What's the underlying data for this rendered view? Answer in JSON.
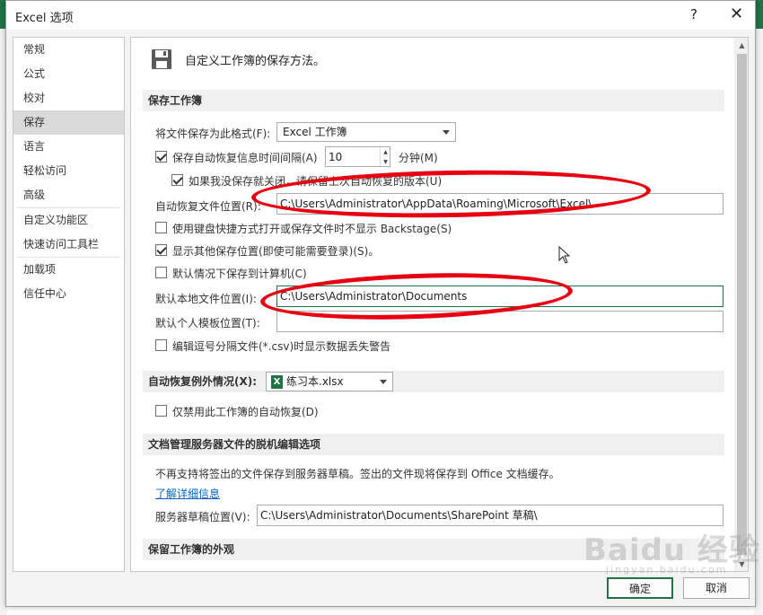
{
  "window": {
    "title": "Excel 选项",
    "help": "?",
    "close": "✕"
  },
  "nav": {
    "items": [
      {
        "label": "常规",
        "selected": false
      },
      {
        "label": "公式",
        "selected": false
      },
      {
        "label": "校对",
        "selected": false
      },
      {
        "label": "保存",
        "selected": true
      },
      {
        "label": "语言",
        "selected": false
      },
      {
        "label": "轻松访问",
        "selected": false
      },
      {
        "label": "高级",
        "selected": false
      },
      {
        "label": "自定义功能区",
        "selected": false
      },
      {
        "label": "快速访问工具栏",
        "selected": false
      },
      {
        "label": "加载项",
        "selected": false
      },
      {
        "label": "信任中心",
        "selected": false
      }
    ]
  },
  "header": {
    "text": "自定义工作簿的保存方法。",
    "icon": "floppy-disk-icon"
  },
  "sections": {
    "save_workbooks": "保存工作簿",
    "autorecover_exceptions": "自动恢复例外情况(X):",
    "offline_editing": "文档管理服务器文件的脱机编辑选项",
    "preserve_visual": "保留工作簿的外观"
  },
  "save": {
    "format_label": "将文件保存为此格式(F):",
    "format_value": "Excel 工作簿",
    "autorecover_label": "保存自动恢复信息时间间隔(A)",
    "autorecover_checked": true,
    "autorecover_minutes": "10",
    "minutes_unit": "分钟(M)",
    "keep_last_label": "如果我没保存就关闭，请保留上次自动恢复的版本(U)",
    "keep_last_checked": true,
    "autorecover_location_label": "自动恢复文件位置(R):",
    "autorecover_location_value": "C:\\Users\\Administrator\\AppData\\Roaming\\Microsoft\\Excel\\",
    "no_backstage_label": "使用键盘快捷方式打开或保存文件时不显示 Backstage(S)",
    "no_backstage_checked": false,
    "show_additional_label": "显示其他保存位置(即使可能需要登录)(S)。",
    "show_additional_checked": true,
    "save_to_computer_label": "默认情况下保存到计算机(C)",
    "save_to_computer_checked": false,
    "default_local_label": "默认本地文件位置(I):",
    "default_local_value": "C:\\Users\\Administrator\\Documents",
    "default_template_label": "默认个人模板位置(T):",
    "default_template_value": "",
    "csv_warning_label": "编辑逗号分隔文件(*.csv)时显示数据丢失警告",
    "csv_warning_checked": false
  },
  "autorecover_exceptions": {
    "workbook": "练习本.xlsx",
    "disable_label": "仅禁用此工作簿的自动恢复(D)",
    "disable_checked": false
  },
  "offline": {
    "note": "不再支持将签出的文件保存到服务器草稿。签出的文件现将保存到 Office 文档缓存。",
    "link": "了解详细信息",
    "drafts_label": "服务器草稿位置(V):",
    "drafts_value": "C:\\Users\\Administrator\\Documents\\SharePoint 草稿\\"
  },
  "buttons": {
    "ok": "确定",
    "cancel": "取消"
  },
  "watermark": {
    "brand": "Baidu 经验",
    "url": "jingyan.baidu.com"
  },
  "colors": {
    "accent": "#217346",
    "annotation": "#e60012",
    "link": "#0563c1"
  }
}
